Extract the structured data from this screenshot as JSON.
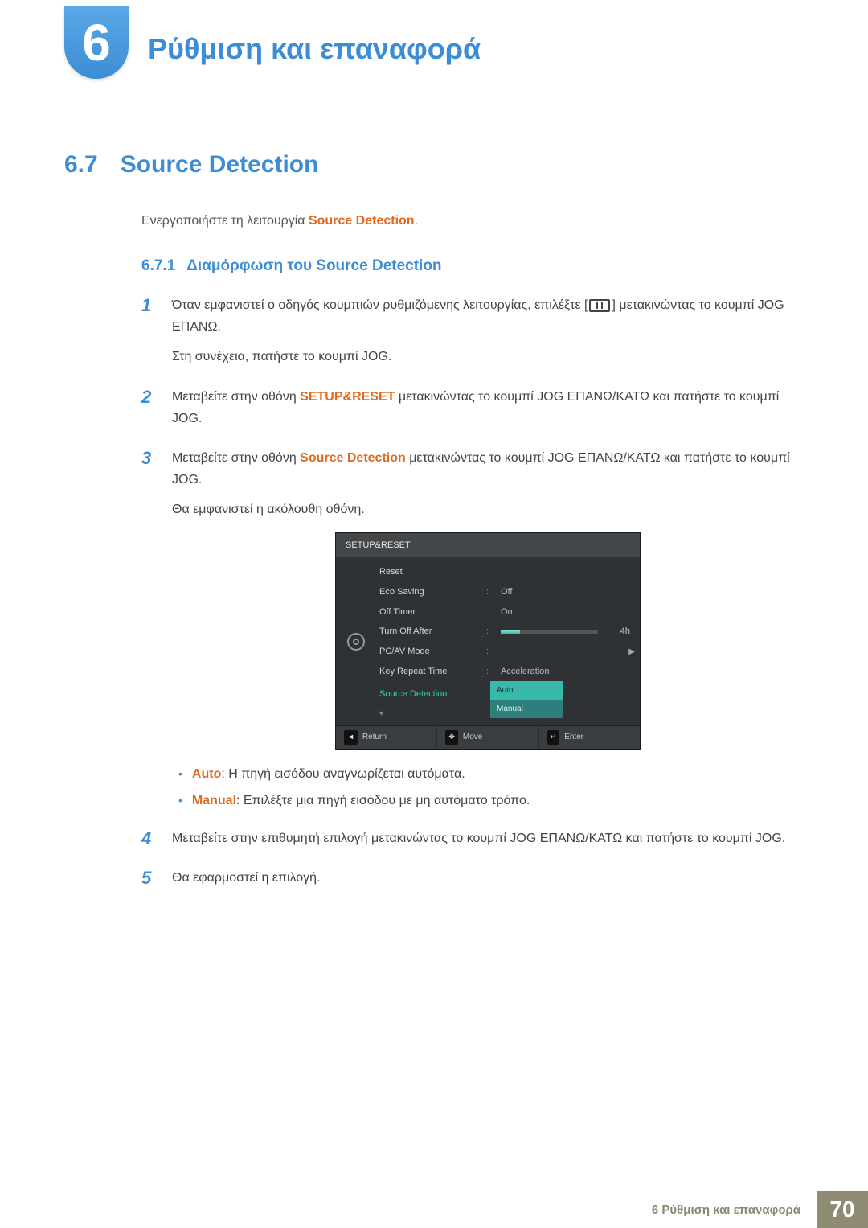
{
  "chapter": {
    "number": "6",
    "title": "Ρύθμιση και επαναφορά"
  },
  "section": {
    "number": "6.7",
    "title": "Source Detection"
  },
  "intro": {
    "prefix": "Ενεργοποιήστε τη λειτουργία ",
    "term": "Source Detection",
    "suffix": "."
  },
  "subsection": {
    "number": "6.7.1",
    "title": "Διαμόρφωση του Source Detection"
  },
  "steps": [
    {
      "n": "1",
      "p1_pre": "Όταν εμφανιστεί ο οδηγός κουμπιών ρυθμιζόμενης λειτουργίας, επιλέξτε [",
      "p1_post": "] μετακινώντας το κουμπί JOG ΕΠΑΝΩ.",
      "p2": "Στη συνέχεια, πατήστε το κουμπί JOG."
    },
    {
      "n": "2",
      "p1_pre": "Μεταβείτε στην οθόνη ",
      "p1_hl": "SETUP&RESET",
      "p1_post": " μετακινώντας το κουμπί JOG ΕΠΑΝΩ/ΚΑΤΩ και πατήστε το κουμπί JOG."
    },
    {
      "n": "3",
      "p1_pre": "Μεταβείτε στην οθόνη ",
      "p1_hl": "Source Detection",
      "p1_post": " μετακινώντας το κουμπί JOG ΕΠΑΝΩ/ΚΑΤΩ και πατήστε το κουμπί JOG.",
      "p2": "Θα εμφανιστεί η ακόλουθη οθόνη."
    },
    {
      "n": "4",
      "p1": "Μεταβείτε στην επιθυμητή επιλογή μετακινώντας το κουμπί JOG ΕΠΑΝΩ/ΚΑΤΩ και πατήστε το κουμπί JOG."
    },
    {
      "n": "5",
      "p1": "Θα εφαρμοστεί η επιλογή."
    }
  ],
  "osd": {
    "title": "SETUP&RESET",
    "rows": {
      "reset": "Reset",
      "eco": {
        "label": "Eco Saving",
        "value": "Off"
      },
      "timer": {
        "label": "Off Timer",
        "value": "On"
      },
      "turnoff": {
        "label": "Turn Off After",
        "value": "4h"
      },
      "pcav": {
        "label": "PC/AV Mode"
      },
      "repeat": {
        "label": "Key Repeat Time",
        "value": "Acceleration"
      },
      "source": {
        "label": "Source Detection"
      }
    },
    "dropdown": {
      "auto": "Auto",
      "manual": "Manual"
    },
    "footer": {
      "return": "Return",
      "move": "Move",
      "enter": "Enter"
    }
  },
  "bullets": {
    "auto": {
      "term": "Auto",
      "text": ": Η πηγή εισόδου αναγνωρίζεται αυτόματα."
    },
    "manual": {
      "term": "Manual",
      "text": ": Επιλέξτε μια πηγή εισόδου με μη αυτόματο τρόπο."
    }
  },
  "footer": {
    "label": "6 Ρύθμιση και επαναφορά",
    "page": "70"
  }
}
